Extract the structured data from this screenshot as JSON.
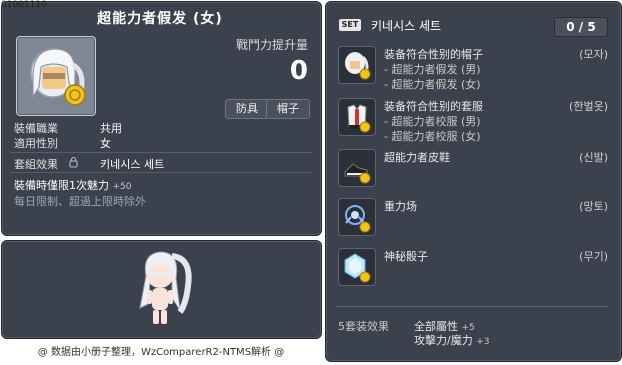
{
  "item": {
    "id": "01001110",
    "title": "超能力者假发 (女)",
    "stat_label": "戰鬥力提升量",
    "stat_value": "0",
    "tags": [
      "防具",
      "帽子"
    ],
    "rows": [
      {
        "label": "裝備職業",
        "value": "共用"
      },
      {
        "label": "適用性別",
        "value": "女"
      }
    ],
    "set_effect_label": "套組效果",
    "set_effect_value": "키네시스 세트",
    "bonus_line": "裝備時僅限1次魅力",
    "bonus_value": "+50",
    "daily_note": "每日限制、超過上限時除外",
    "credit": "@ 数据由小册子整理，WzComparerR2-NTMS解析 @"
  },
  "set": {
    "badge": "SET",
    "name": "키네시스 세트",
    "count": "0 / 5",
    "items": [
      {
        "name": "装备符合性别的帽子",
        "subs": [
          "- 超能力者假发 (男)",
          "- 超能力者假发 (女)"
        ],
        "slot": "(모자)",
        "icon": "wig-icon"
      },
      {
        "name": "装备符合性别的套服",
        "subs": [
          "- 超能力者校服 (男)",
          "- 超能力者校服 (女)"
        ],
        "slot": "(한벌옷)",
        "icon": "uniform-icon"
      },
      {
        "name": "超能力者皮鞋",
        "subs": [],
        "slot": "(신발)",
        "icon": "shoes-icon"
      },
      {
        "name": "重力场",
        "subs": [],
        "slot": "(망토)",
        "icon": "cape-icon"
      },
      {
        "name": "神秘骰子",
        "subs": [],
        "slot": "(무기)",
        "icon": "dice-icon"
      }
    ],
    "effect_label": "5套装效果",
    "effects": [
      {
        "text": "全部屬性",
        "value": "+5"
      },
      {
        "text": "攻擊力/魔力",
        "value": "+3"
      }
    ]
  },
  "colors": {
    "panel_bg": "#3b414d",
    "coin": "#f0c419"
  }
}
